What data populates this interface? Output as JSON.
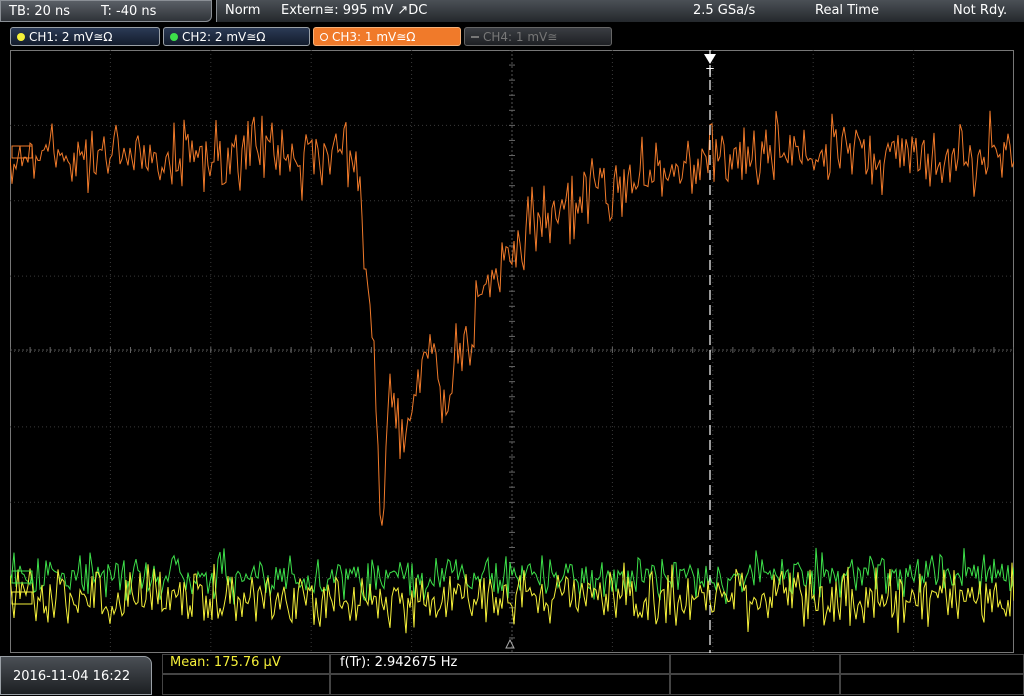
{
  "timebase": {
    "tb": "TB: 20 ns",
    "t": "T: -40 ns"
  },
  "trigger_bar": {
    "mode": "Norm",
    "source": "Extern≅: 995 mV ↗DC",
    "sample_rate": "2.5 GSa/s",
    "acq_mode": "Real Time",
    "status": "Not Rdy."
  },
  "channels": [
    {
      "label": "CH1: 2 mV≅Ω",
      "color": "#f5f03a",
      "state": "on"
    },
    {
      "label": "CH2: 2 mV≅Ω",
      "color": "#3de04a",
      "state": "on"
    },
    {
      "label": "CH3: 1 mV≅Ω",
      "color": "#f07a2a",
      "state": "active"
    },
    {
      "label": "CH4: 1 mV≅",
      "color": "#777777",
      "state": "off"
    }
  ],
  "trigger_marker": "T",
  "measurements": {
    "mean": "Mean: 175.76 µV",
    "freq": "f(Tr): 2.942675 Hz"
  },
  "datetime": "2016-11-04 16:22",
  "colors": {
    "ch1": "#f5f03a",
    "ch2": "#3de04a",
    "ch3": "#f07a2a",
    "grid": "#3a3a3a"
  }
}
